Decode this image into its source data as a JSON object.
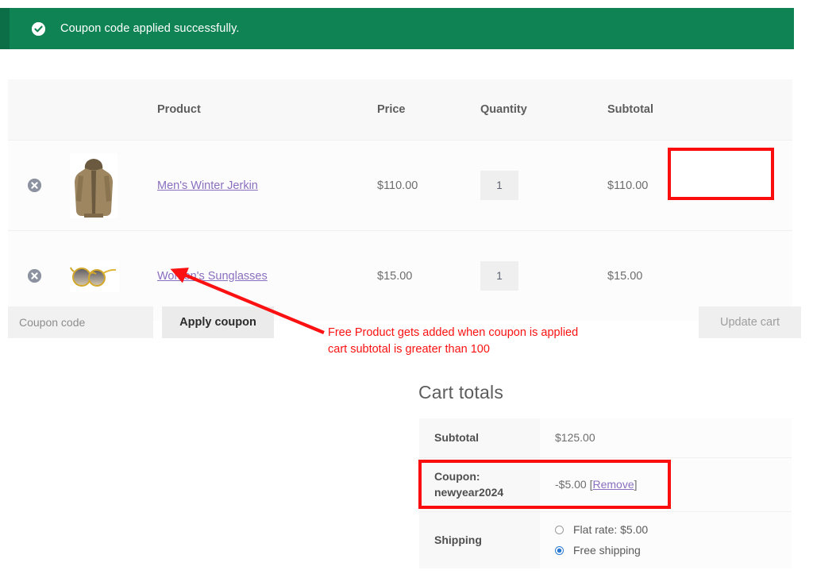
{
  "notice": {
    "icon": "check-circle-icon",
    "message": "Coupon code applied successfully.",
    "bg_color": "#0f8354",
    "border_color": "#0c6e46"
  },
  "cart_table": {
    "columns": [
      "",
      "",
      "Product",
      "Price",
      "Quantity",
      "Subtotal"
    ],
    "headers": {
      "product": "Product",
      "price": "Price",
      "quantity": "Quantity",
      "subtotal": "Subtotal"
    },
    "rows": [
      {
        "remove_icon": "remove-item-icon",
        "thumbnail": "mens-winter-jerkin-thumbnail",
        "name": "Men's Winter Jerkin",
        "price": "$110.00",
        "quantity": "1",
        "subtotal": "$110.00"
      },
      {
        "remove_icon": "remove-item-icon",
        "thumbnail": "womens-sunglasses-thumbnail",
        "name": "Women's Sunglasses",
        "price": "$15.00",
        "quantity": "1",
        "subtotal": "$15.00"
      }
    ]
  },
  "coupon_row": {
    "input_value": "",
    "input_placeholder": "Coupon code",
    "apply_label": "Apply coupon",
    "update_label": "Update cart"
  },
  "cart_totals": {
    "title": "Cart totals",
    "subtotal_label": "Subtotal",
    "subtotal_value": "$125.00",
    "coupon_label": "Coupon: newyear2024",
    "coupon_amount": "-$5.00 ",
    "coupon_remove_open": "[",
    "coupon_remove_label": "Remove",
    "coupon_remove_close": "]",
    "shipping_label": "Shipping",
    "shipping_options": [
      {
        "label": "Flat rate: $5.00",
        "selected": false
      },
      {
        "label": "Free shipping",
        "selected": true
      }
    ]
  },
  "annotations": {
    "highlight_color": "#fc0d0d",
    "note_text": "Free Product gets added when coupon is applied\ncart subtotal is greater than 100",
    "highlight_subtotal_target": "$110.00",
    "highlight_coupon_target": "Coupon: newyear2024",
    "arrow": "red-arrow-pointing-to-sunglasses-thumbnail"
  }
}
